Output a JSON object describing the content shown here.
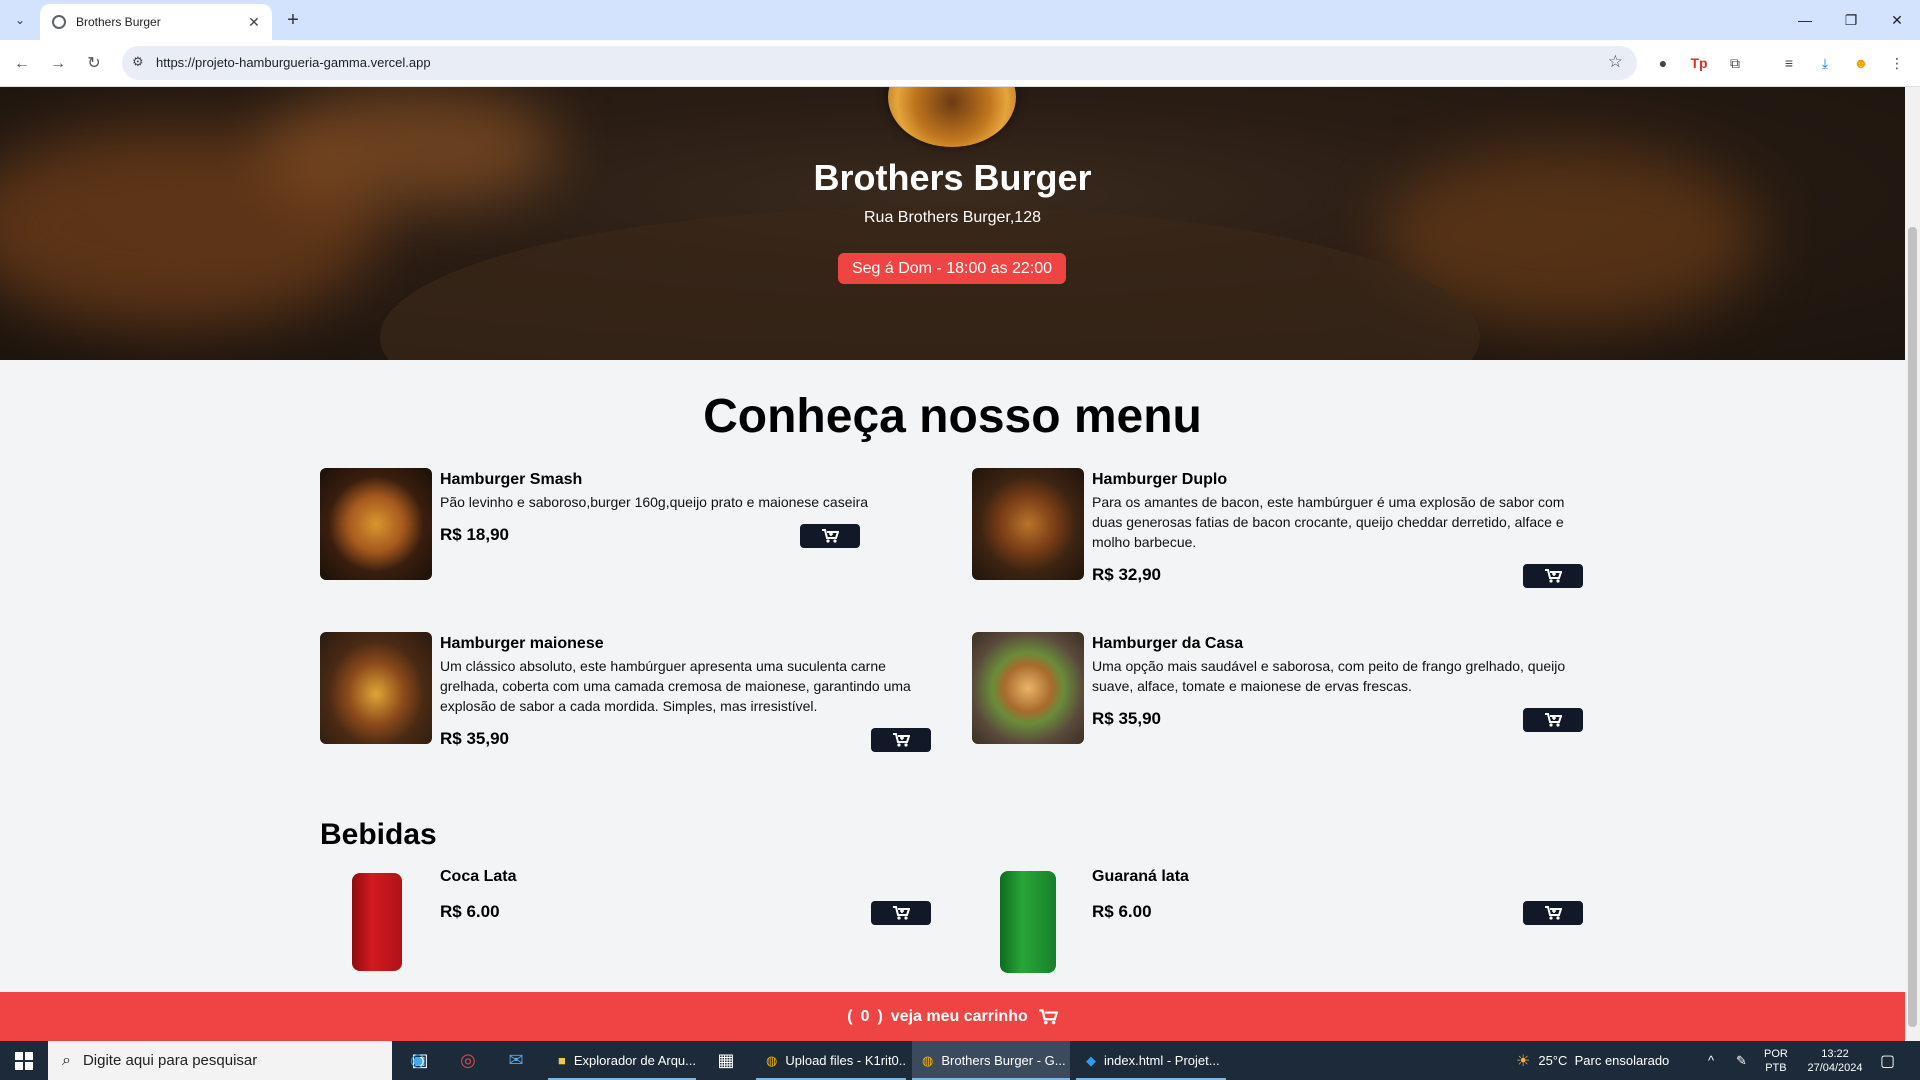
{
  "browser": {
    "tab_title": "Brothers Burger",
    "url": "https://projeto-hamburgueria-gamma.vercel.app"
  },
  "hero": {
    "title": "Brothers Burger",
    "address": "Rua Brothers Burger,128",
    "hours": "Seg á Dom - 18:00 as 22:00"
  },
  "menu": {
    "title": "Conheça nosso menu",
    "burgers": [
      {
        "name": "Hamburger Smash",
        "description": "Pão levinho e saboroso,burger 160g,queijo prato e maionese caseira",
        "price": "R$ 18,90"
      },
      {
        "name": "Hamburger Duplo",
        "description": "Para os amantes de bacon, este hambúrguer é uma explosão de sabor com duas generosas fatias de bacon crocante, queijo cheddar derretido, alface e molho barbecue.",
        "price": "R$ 32,90"
      },
      {
        "name": "Hamburger maionese",
        "description": "Um clássico absoluto, este hambúrguer apresenta uma suculenta carne grelhada, coberta com uma camada cremosa de maionese, garantindo uma explosão de sabor a cada mordida. Simples, mas irresistível.",
        "price": "R$ 35,90"
      },
      {
        "name": "Hamburger da Casa",
        "description": "Uma opção mais saudável e saborosa, com peito de frango grelhado, queijo suave, alface, tomate e maionese de ervas frescas.",
        "price": "R$ 35,90"
      }
    ],
    "drinks_title": "Bebidas",
    "drinks": [
      {
        "name": "Coca Lata",
        "price": "R$ 6.00"
      },
      {
        "name": "Guaraná lata",
        "price": "R$ 6.00"
      }
    ]
  },
  "cart": {
    "open": "(",
    "count": "0",
    "close": ")",
    "label": "veja meu carrinho"
  },
  "taskbar": {
    "search_placeholder": "Digite aqui para pesquisar",
    "apps": [
      {
        "label": "Explorador de Arqu..."
      },
      {
        "label": "Upload files - K1rit0..."
      },
      {
        "label": "Brothers Burger - G..."
      },
      {
        "label": "index.html - Projet..."
      }
    ],
    "weather": "25°C  Parc ensolarado",
    "lang_1": "POR",
    "lang_2": "PTB",
    "time": "13:22",
    "date": "27/04/2024"
  },
  "colors": {
    "accent_red": "#ef4444",
    "button_dark": "#111827",
    "page_bg": "#f3f4f6"
  }
}
